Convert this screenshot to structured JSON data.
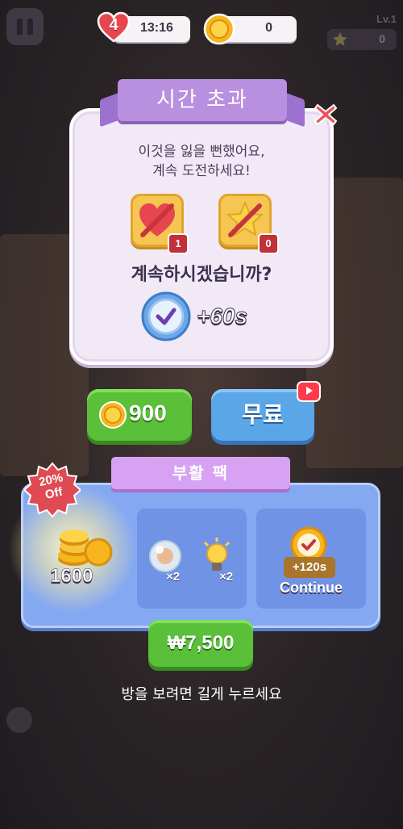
{
  "hud": {
    "lives": "4",
    "lives_timer": "13:16",
    "coins": "0",
    "level": "Lv.1",
    "stars": "0"
  },
  "timeout_panel": {
    "title": "시간 초과",
    "message_line1": "이것을 잃을 뻔했어요,",
    "message_line2": "계속 도전하세요!",
    "heart_booster_count": "1",
    "star_booster_count": "0",
    "question": "계속하시겠습니까?",
    "time_bonus": "+60s"
  },
  "buttons": {
    "coin_price": "900",
    "free_label": "무료"
  },
  "revive_pack": {
    "title": "부활 팩",
    "discount_line1": "20%",
    "discount_line2": "Off",
    "coins": "1600",
    "orb_qty": "×2",
    "bulb_qty": "×2",
    "time_bonus": "+120s",
    "continue_label": "Continue",
    "price": "₩7,500"
  },
  "hint": "방을 보려면 길게 누르세요",
  "colors": {
    "green": "#5ac03a",
    "blue": "#5aa6e6",
    "purple": "#b98fe0",
    "pack_blue": "#84a8f2",
    "red": "#e8464f"
  },
  "icons": [
    "pause-icon",
    "heart-icon",
    "coin-icon",
    "star-icon",
    "close-icon",
    "broken-heart-icon",
    "broken-star-icon",
    "clock-icon",
    "video-icon",
    "coin-stack-icon",
    "orb-icon",
    "bulb-icon",
    "gold-clock-icon"
  ]
}
